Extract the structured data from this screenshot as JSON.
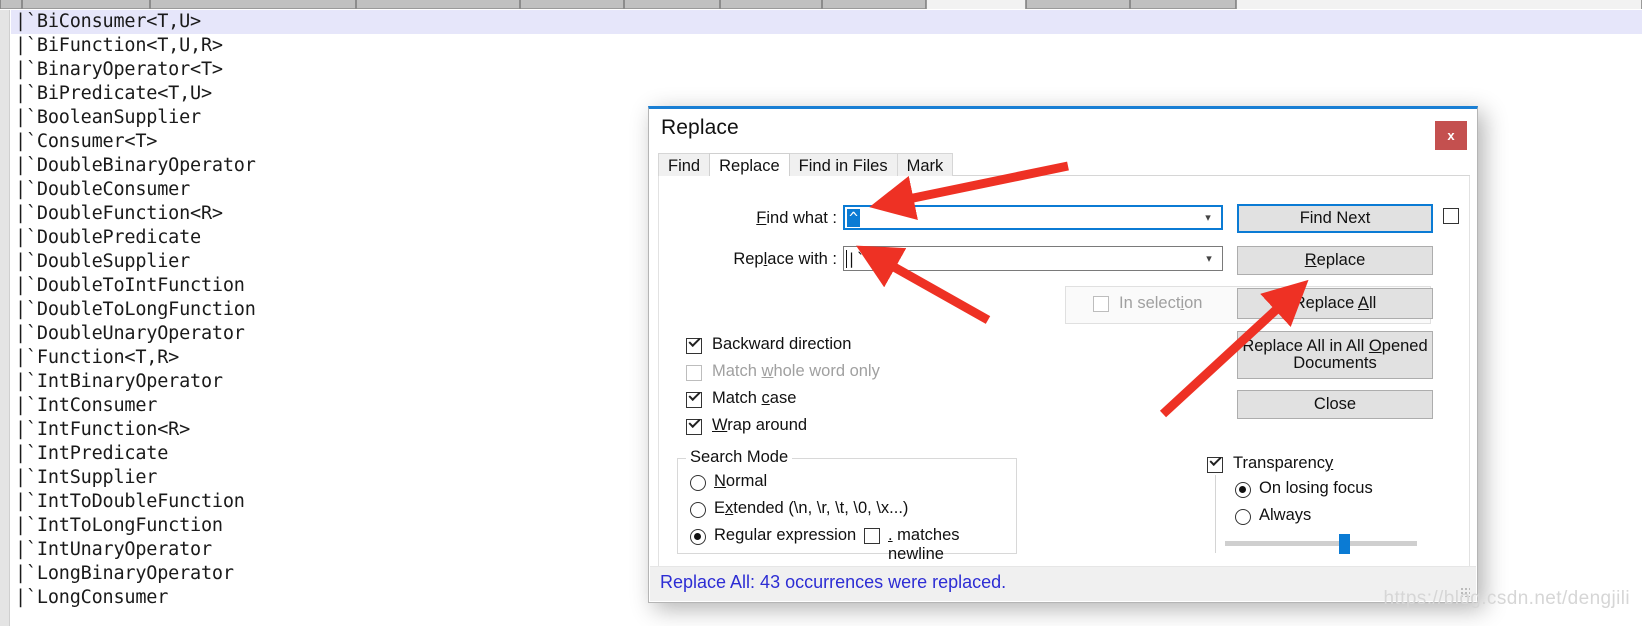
{
  "editor": {
    "lines": [
      "|`BiConsumer<T,U>",
      "|`BiFunction<T,U,R>",
      "|`BinaryOperator<T>",
      "|`BiPredicate<T,U>",
      "|`BooleanSupplier",
      "|`Consumer<T>",
      "|`DoubleBinaryOperator",
      "|`DoubleConsumer",
      "|`DoubleFunction<R>",
      "|`DoublePredicate",
      "|`DoubleSupplier",
      "|`DoubleToIntFunction",
      "|`DoubleToLongFunction",
      "|`DoubleUnaryOperator",
      "|`Function<T,R>",
      "|`IntBinaryOperator",
      "|`IntConsumer",
      "|`IntFunction<R>",
      "|`IntPredicate",
      "|`IntSupplier",
      "|`IntToDoubleFunction",
      "|`IntToLongFunction",
      "|`IntUnaryOperator",
      "|`LongBinaryOperator",
      "|`LongConsumer"
    ],
    "current_line_index": 0
  },
  "dialog": {
    "title": "Replace",
    "close_label": "x",
    "tabs": [
      {
        "label": "Find",
        "active": false
      },
      {
        "label": "Replace",
        "active": true
      },
      {
        "label": "Find in Files",
        "active": false
      },
      {
        "label": "Mark",
        "active": false
      }
    ],
    "fields": {
      "find_what_label": "Find what :",
      "find_what_label_accel": "F",
      "find_what_value": "^",
      "replace_with_label": "Replace with :",
      "replace_with_label_accel": "l",
      "replace_with_value": "|`"
    },
    "buttons": {
      "find_next": "Find Next",
      "replace": "Replace",
      "replace_all": "Replace All",
      "replace_all_opened": "Replace All in All Opened Documents",
      "close": "Close"
    },
    "in_selection": {
      "label": "In selection",
      "checked": false,
      "disabled": true
    },
    "options": [
      {
        "label": "Backward direction",
        "checked": true,
        "disabled": false
      },
      {
        "label": "Match whole word only",
        "checked": false,
        "disabled": true
      },
      {
        "label": "Match case",
        "checked": true,
        "disabled": false
      },
      {
        "label": "Wrap around",
        "checked": true,
        "disabled": false
      }
    ],
    "search_mode": {
      "title": "Search Mode",
      "items": [
        {
          "label": "Normal",
          "selected": false
        },
        {
          "label": "Extended (\\n, \\r, \\t, \\0, \\x...)",
          "selected": false
        },
        {
          "label": "Regular expression",
          "selected": true
        }
      ],
      "matches_newline": {
        "label": ". matches newline",
        "checked": false
      }
    },
    "transparency": {
      "label": "Transparency",
      "checked": true,
      "items": [
        {
          "label": "On losing focus",
          "selected": true
        },
        {
          "label": "Always",
          "selected": false
        }
      ],
      "slider_percent": 62
    },
    "status_message": "Replace All: 43 occurrences were replaced.",
    "colors": {
      "accent": "#0b7bd4",
      "close_btn": "#c4504f",
      "status_text": "#2d2dd4",
      "arrow": "#ee3124"
    }
  },
  "watermark": "https://blog.csdn.net/dengjili"
}
